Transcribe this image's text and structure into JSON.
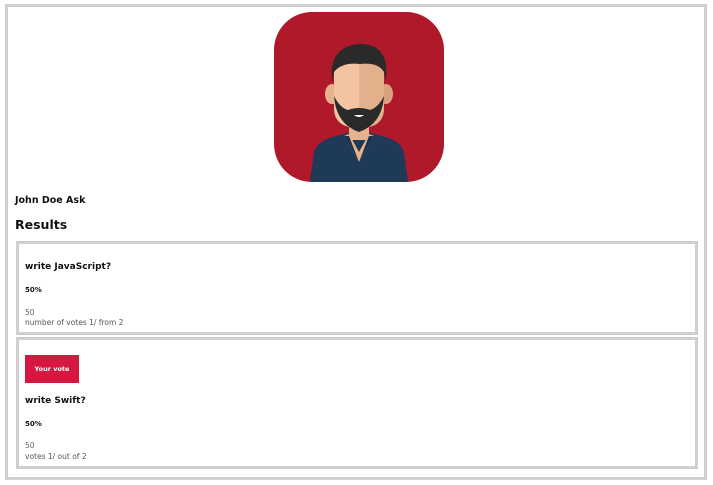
{
  "author": {
    "name": "John Doe Ask"
  },
  "results": {
    "heading": "Results",
    "options": [
      {
        "question": "write JavaScript?",
        "percent": "50%",
        "value": "50",
        "votes_text": "number of votes 1/ from 2"
      },
      {
        "badge": "Your vote",
        "question": "write Swift?",
        "percent": "50%",
        "value": "50",
        "votes_text": "votes 1/ out of 2"
      }
    ]
  },
  "colors": {
    "avatar_bg": "#b0192a",
    "badge_bg": "#d6173f",
    "border": "#cfcfcf"
  },
  "icons": {
    "avatar": "bearded-man-avatar-icon"
  }
}
